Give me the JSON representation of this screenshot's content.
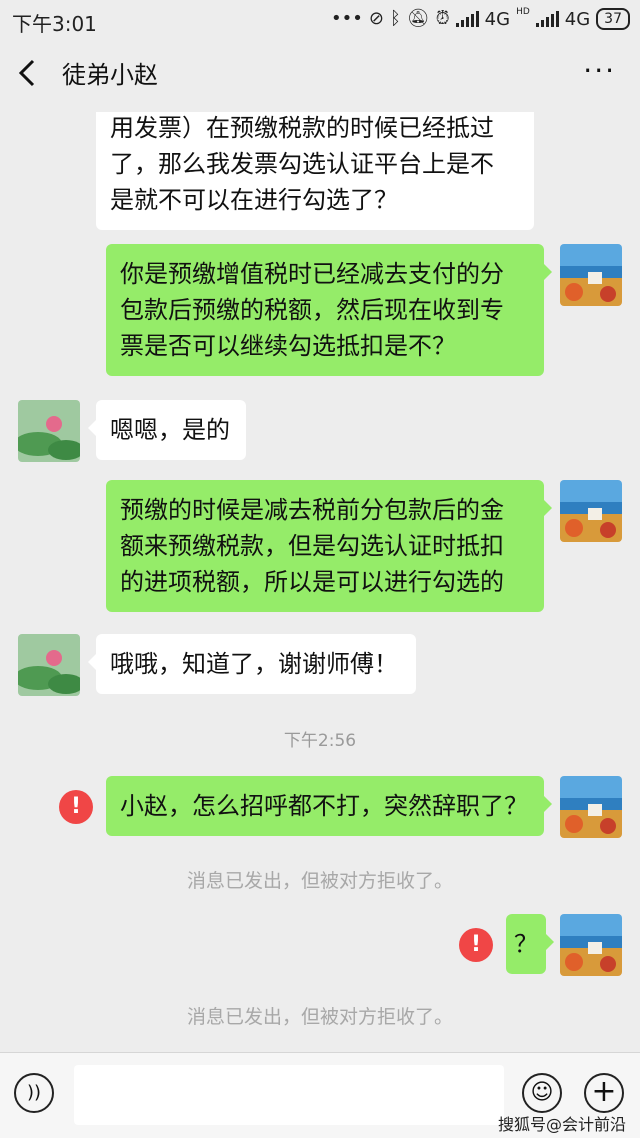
{
  "status_bar": {
    "time": "下午3:01",
    "more_dots": "•••",
    "net1": "4G",
    "net2_hd": "HD",
    "net2": "4G",
    "battery": "37"
  },
  "header": {
    "back_icon": "‹",
    "title": "徒弟小赵",
    "more_icon": "···"
  },
  "messages": [
    {
      "side": "in",
      "lines": [
        "用发票）在预缴税款的时候已经抵过",
        "了，那么我发票勾选认证平台上是不",
        "是就不可以在进行勾选了？"
      ]
    },
    {
      "side": "out",
      "lines": [
        "你是预缴增值税时已经减去支付的分",
        "包款后预缴的税额，然后现在收到专",
        "票是否可以继续勾选抵扣是不？"
      ]
    },
    {
      "side": "in",
      "lines": [
        "嗯嗯，是的"
      ]
    },
    {
      "side": "out",
      "lines": [
        "预缴的时候是减去税前分包款后的金",
        "额来预缴税款，但是勾选认证时抵扣",
        "的进项税额，所以是可以进行勾选的"
      ]
    },
    {
      "side": "in",
      "lines": [
        "哦哦，知道了，谢谢师傅！"
      ]
    },
    {
      "side": "out",
      "lines": [
        "小赵，怎么招呼都不打，突然辞职了？"
      ],
      "failed": true
    },
    {
      "side": "out",
      "lines": [
        "？"
      ],
      "failed": true
    }
  ],
  "timestamp": "下午2:56",
  "system_notices": [
    "消息已发出，但被对方拒收了。",
    "消息已发出，但被对方拒收了。"
  ],
  "fail_icon": "!",
  "input_bar": {
    "voice_icon": "))",
    "emoji_icon": "☺",
    "plus_icon": "+"
  },
  "watermark": "搜狐号@会计前沿",
  "colors": {
    "background": "#ededed",
    "outgoing_bubble": "#95ec69",
    "incoming_bubble": "#ffffff",
    "fail_badge": "#f04646"
  }
}
